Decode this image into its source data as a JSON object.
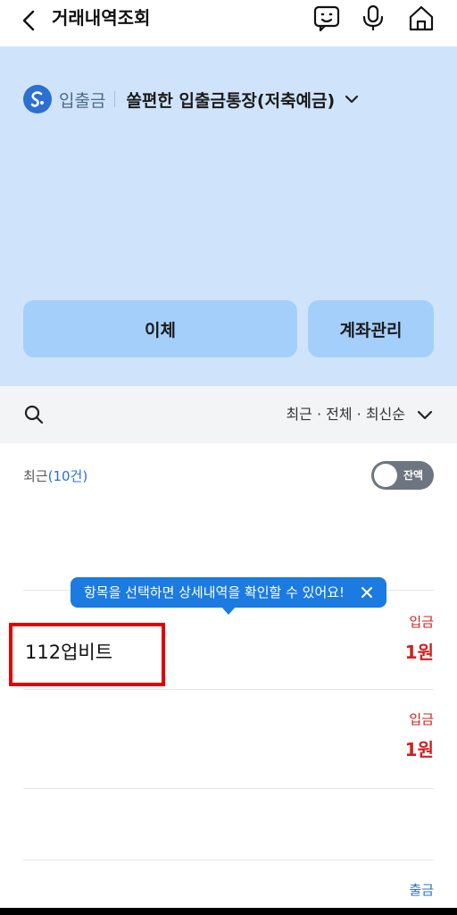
{
  "header": {
    "title": "거래내역조회",
    "icons": [
      "chevron-left-icon",
      "chatbot-icon",
      "microphone-icon",
      "home-icon"
    ]
  },
  "account": {
    "type": "입출금",
    "name": "쏠편한 입출금통장(저축예금)"
  },
  "actions": {
    "transfer": "이체",
    "manage": "계좌관리"
  },
  "filter": {
    "summary": "최근 · 전체 · 최신순"
  },
  "list": {
    "recent_label": "최근",
    "recent_count": "(10건)",
    "balance_toggle": "잔액",
    "balance_toggle_on": false
  },
  "tooltip": {
    "text": "항목을 선택하면 상세내역을 확인할 수 있어요!"
  },
  "transactions": [
    {
      "type": "입금",
      "name": "112업비트",
      "amount": "1원"
    },
    {
      "type": "입금",
      "name": "",
      "amount": "1원"
    },
    {
      "type": "출금",
      "name": "",
      "amount": ""
    }
  ],
  "colors": {
    "hero_bg": "#cfe4fb",
    "button_bg": "#a5cffb",
    "deposit": "#d21f1f",
    "withdraw": "#2b6fd1",
    "tooltip_bg": "#1b7be0",
    "highlight": "#e30000"
  }
}
